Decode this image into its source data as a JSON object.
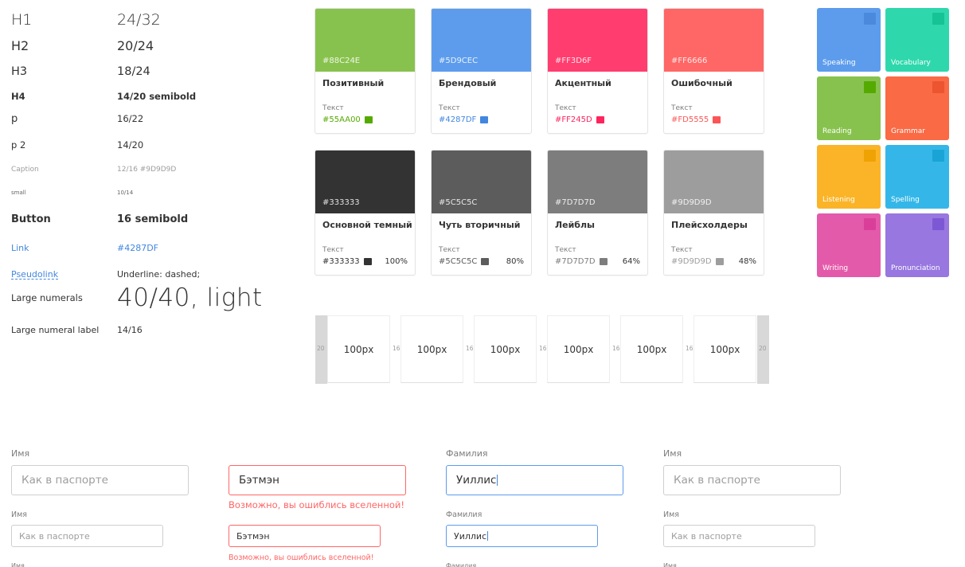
{
  "typography": [
    {
      "label": "H1",
      "value": "24/32"
    },
    {
      "label": "H2",
      "value": "20/24"
    },
    {
      "label": "H3",
      "value": "18/24"
    },
    {
      "label": "H4",
      "value": "14/20 semibold"
    },
    {
      "label": "p",
      "value": "16/22"
    },
    {
      "label": "p 2",
      "value": "14/20"
    },
    {
      "label": "Caption",
      "value": "12/16 #9D9D9D"
    },
    {
      "label": "small",
      "value": "10/14"
    },
    {
      "label": "Button",
      "value": "16 semibold"
    },
    {
      "label": "Link",
      "value": "#4287DF"
    },
    {
      "label": "Pseudolink",
      "value": "Underline: dashed;"
    },
    {
      "label": "Large numerals",
      "value": "40/40, light"
    },
    {
      "label": "Large numeral label",
      "value": "14/16"
    }
  ],
  "colors": {
    "link": "#4287DF",
    "error": "#FF6666",
    "focus": "#5D9CEC",
    "placeholder": "#9D9D9D"
  },
  "color_cards": [
    {
      "hex": "#88C24E",
      "name": "Позитивный",
      "text_label": "Текст",
      "text_hex": "#55AA00",
      "percent": ""
    },
    {
      "hex": "#5D9CEC",
      "name": "Брендовый",
      "text_label": "Текст",
      "text_hex": "#4287DF",
      "percent": ""
    },
    {
      "hex": "#FF3D6F",
      "name": "Акцентный",
      "text_label": "Текст",
      "text_hex": "#FF245D",
      "percent": ""
    },
    {
      "hex": "#FF6666",
      "name": "Ошибочный",
      "text_label": "Текст",
      "text_hex": "#FD5555",
      "percent": ""
    },
    {
      "hex": "#333333",
      "name": "Основной темный",
      "text_label": "Текст",
      "text_hex": "#333333",
      "percent": "100%"
    },
    {
      "hex": "#5C5C5C",
      "name": "Чуть вторичный",
      "text_label": "Текст",
      "text_hex": "#5C5C5C",
      "percent": "80%"
    },
    {
      "hex": "#7D7D7D",
      "name": "Лейблы",
      "text_label": "Текст",
      "text_hex": "#7D7D7D",
      "percent": "64%"
    },
    {
      "hex": "#9D9D9D",
      "name": "Плейсхолдеры",
      "text_label": "Текст",
      "text_hex": "#9D9D9D",
      "percent": "48%"
    }
  ],
  "tiles": [
    {
      "name": "Speaking",
      "color": "#5D9CEC",
      "corner": "#4A89DC"
    },
    {
      "name": "Vocabulary",
      "color": "#2FD8AC",
      "corner": "#15C394"
    },
    {
      "name": "Reading",
      "color": "#88C24E",
      "corner": "#55AA00"
    },
    {
      "name": "Grammar",
      "color": "#F96A45",
      "corner": "#EC5530"
    },
    {
      "name": "Listening",
      "color": "#FBB428",
      "corner": "#EFA204"
    },
    {
      "name": "Spelling",
      "color": "#34B7E8",
      "corner": "#1AA4D6"
    },
    {
      "name": "Writing",
      "color": "#E45AAA",
      "corner": "#D93F98"
    },
    {
      "name": "Pronunciation",
      "color": "#9877E0",
      "corner": "#7D58D4"
    }
  ],
  "spacing": {
    "outer": "20",
    "gap": "16",
    "box_label": "100px",
    "box_count": 6
  },
  "forms": {
    "name_label": "Имя",
    "surname_label": "Фамилия",
    "placeholder": "Как в паспорте",
    "error_value": "Бэтмэн",
    "error_message": "Возможно, вы ошиблись вселенной!",
    "focus_value": "Уиллис"
  }
}
